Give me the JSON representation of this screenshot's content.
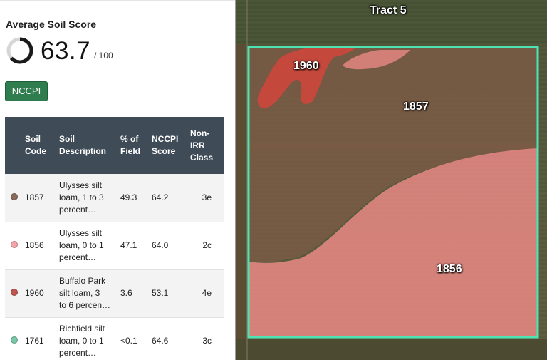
{
  "summary": {
    "title": "Average Soil Score",
    "score": "63.7",
    "score_max": "/ 100",
    "score_fraction": 0.637
  },
  "nccpi_button": {
    "label": "NCCPI"
  },
  "table": {
    "headers": {
      "code": [
        "Soil",
        "Code"
      ],
      "desc": [
        "Soil",
        "Description"
      ],
      "pct": [
        "% of",
        "Field"
      ],
      "score": [
        "NCCPI",
        "Score"
      ],
      "class": [
        "Non-",
        "IRR",
        "Class"
      ]
    },
    "rows": [
      {
        "color": "#8a6a5a",
        "code": "1857",
        "desc": [
          "Ulysses silt",
          "loam, 1 to 3",
          "percent…"
        ],
        "pct": "49.3",
        "score": "64.2",
        "class": "3e"
      },
      {
        "color": "#f4a3a8",
        "code": "1856",
        "desc": [
          "Ulysses silt",
          "loam, 0 to 1",
          "percent…"
        ],
        "pct": "47.1",
        "score": "64.0",
        "class": "2c"
      },
      {
        "color": "#c0564f",
        "code": "1960",
        "desc": [
          "Buffalo Park",
          "silt loam, 3",
          "to 6 percen…"
        ],
        "pct": "3.6",
        "score": "53.1",
        "class": "4e"
      },
      {
        "color": "#79c9a8",
        "code": "1761",
        "desc": [
          "Richfield silt",
          "loam, 0 to 1",
          "percent…"
        ],
        "pct": "<0.1",
        "score": "64.6",
        "class": "3c"
      }
    ]
  },
  "map": {
    "tract_label": "Tract 5",
    "zone_labels": {
      "z1960": "1960",
      "z1857": "1857",
      "z1856": "1856"
    },
    "colors": {
      "boundary": "#4ee3b2",
      "zone_1857": "#8a6a5a",
      "zone_1856": "#f08e8e",
      "zone_1960": "#d64a3e"
    }
  }
}
